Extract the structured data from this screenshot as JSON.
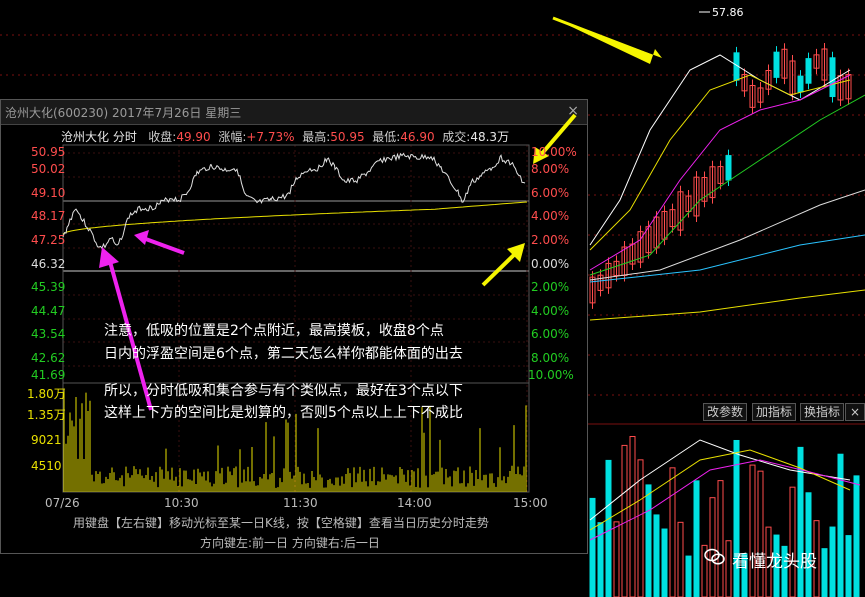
{
  "background": {
    "top_price_label": "57.86"
  },
  "popup": {
    "title": "沧州大化(600230) 2017年7月26日 星期三",
    "close_label": "×",
    "info": {
      "name": "沧州大化 分时",
      "close_label": "收盘:",
      "close_value": "49.90",
      "change_label": "涨幅:",
      "change_value": "+7.73%",
      "high_label": "最高:",
      "high_value": "50.95",
      "low_label": "最低:",
      "low_value": "46.90",
      "volume_label": "成交:",
      "volume_value": "48.3万"
    },
    "price_axis": [
      "50.95",
      "50.02",
      "49.10",
      "48.17",
      "47.25",
      "46.32",
      "45.39",
      "44.47",
      "43.54",
      "42.62",
      "41.69"
    ],
    "pct_axis": [
      "10.00%",
      "8.00%",
      "6.00%",
      "4.00%",
      "2.00%",
      "0.00%",
      "2.00%",
      "4.00%",
      "6.00%",
      "8.00%",
      "10.00%"
    ],
    "volume_axis": [
      "1.80万",
      "1.35万",
      "9021",
      "4510"
    ],
    "time_axis": [
      "07/26",
      "10:30",
      "11:30",
      "14:00",
      "15:00"
    ],
    "annotations": [
      "注意，低吸的位置是2个点附近，最高摸板，收盘8个点",
      "日内的浮盈空间是6个点，第二天怎么样你都能体面的出去",
      "所以，分时低吸和集合参与有个类似点，最好在3个点以下",
      "这样上下方的空间比是划算的，否则5个点以上上下不成比"
    ],
    "footer": [
      "用键盘【左右键】移动光标至某一日K线，按【空格键】查看当日历史分时走势",
      "方向键左:前一日    方向键右:后一日"
    ]
  },
  "buttons": {
    "params": "改参数",
    "add_indicator": "加指标",
    "switch_indicator": "换指标",
    "close": "×"
  },
  "watermark": "看懂龙头股",
  "colors": {
    "up": "#ff4d4d",
    "down": "#00e0e0",
    "price_line": "#e0e0e0",
    "avg_line": "#e8e000",
    "arrow_yellow": "#f5f500",
    "arrow_magenta": "#ee22ee",
    "ma_white": "#ffffff",
    "ma_yellow": "#e8e000",
    "ma_magenta": "#ee22ee",
    "ma_green": "#22cc22"
  }
}
